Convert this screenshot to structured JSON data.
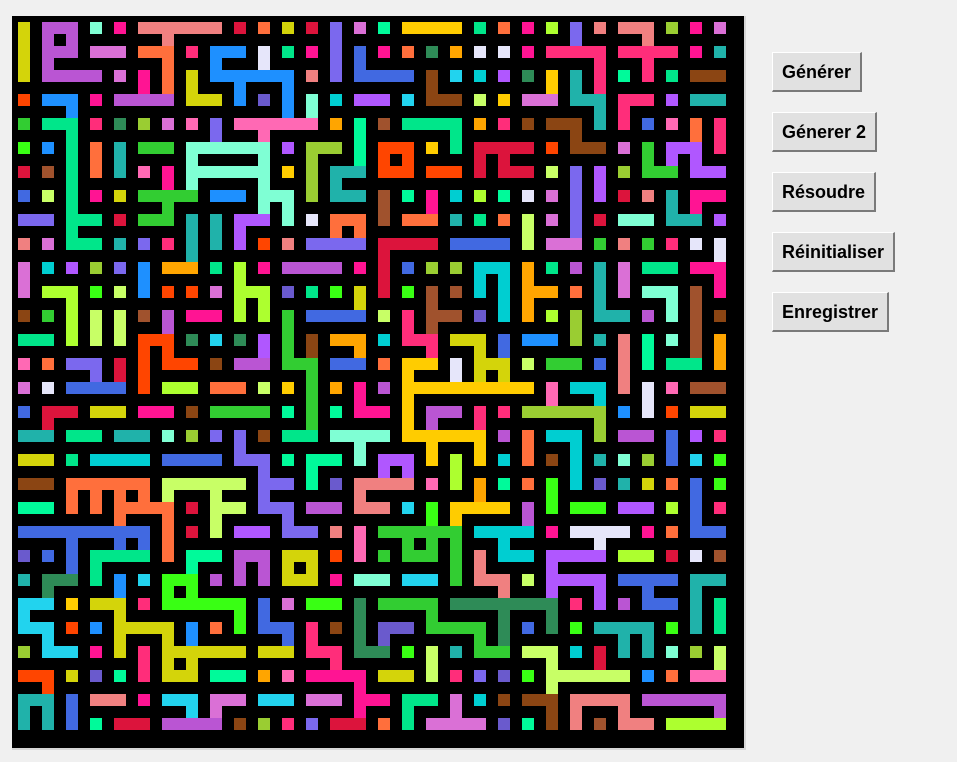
{
  "toolbar": {
    "generate_label": "Générer",
    "generate2_label": "Génerer 2",
    "solve_label": "Résoudre",
    "reset_label": "Réinitialiser",
    "save_label": "Enregistrer"
  },
  "maze": {
    "background_color": "#000000",
    "palette": [
      "#22d3ee",
      "#d4d40a",
      "#39ff14",
      "#ff2d7a",
      "#7b68ee",
      "#ffcc00",
      "#00e68a",
      "#ff6f3c",
      "#c8ff66",
      "#b057ff",
      "#20b2aa",
      "#e6e6fa",
      "#ff1493",
      "#1e90ff",
      "#9acd32",
      "#dc143c",
      "#00fa9a",
      "#8b4513",
      "#ff69b4",
      "#4169e1",
      "#adff2f",
      "#ba55d3",
      "#ffa500",
      "#2e8b57",
      "#f08080",
      "#6a5acd",
      "#7fffd4",
      "#a0522d",
      "#32cd32",
      "#ff4500",
      "#da70d6",
      "#00ced1"
    ]
  }
}
